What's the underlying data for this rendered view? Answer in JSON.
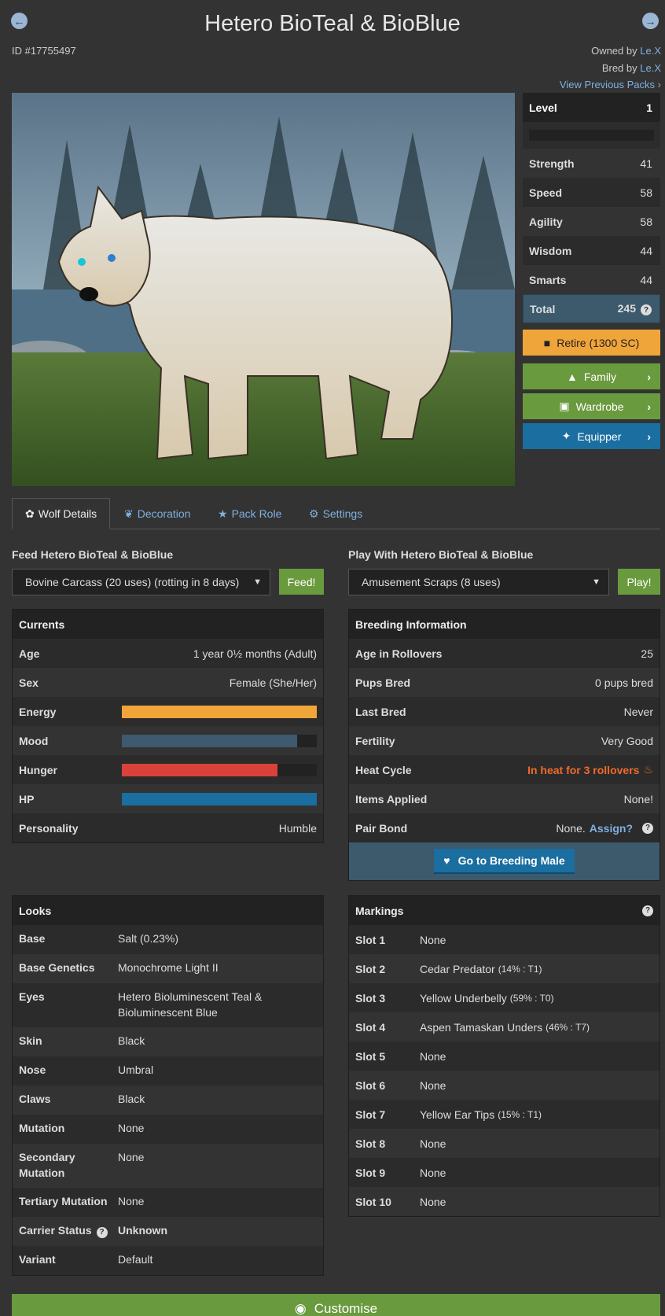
{
  "header": {
    "title": "Hetero BioTeal & BioBlue",
    "id_text": "ID #17755497",
    "owned_by_label": "Owned by",
    "owner": "Le.X",
    "bred_by_label": "Bred by",
    "breeder": "Le.X",
    "view_previous_packs": "View Previous Packs",
    "prev_icon": "arrow-left-icon",
    "next_icon": "arrow-right-icon"
  },
  "stats": {
    "level_label": "Level",
    "level": "1",
    "xp_progress": 0,
    "rows": [
      {
        "label": "Strength",
        "value": "41"
      },
      {
        "label": "Speed",
        "value": "58"
      },
      {
        "label": "Agility",
        "value": "58"
      },
      {
        "label": "Wisdom",
        "value": "44"
      },
      {
        "label": "Smarts",
        "value": "44"
      }
    ],
    "total_label": "Total",
    "total": "245"
  },
  "side_buttons": {
    "retire": "Retire (1300 SC)",
    "family": "Family",
    "wardrobe": "Wardrobe",
    "equipper": "Equipper"
  },
  "tabs": [
    "Wolf Details",
    "Decoration",
    "Pack Role",
    "Settings"
  ],
  "feed": {
    "label": "Feed Hetero BioTeal & BioBlue",
    "selected": "Bovine Carcass (20 uses) (rotting in 8 days)",
    "button": "Feed!"
  },
  "play": {
    "label": "Play With Hetero BioTeal & BioBlue",
    "selected": "Amusement Scraps (8 uses)",
    "button": "Play!"
  },
  "currents": {
    "title": "Currents",
    "age_label": "Age",
    "age": "1 year 0½ months (Adult)",
    "sex_label": "Sex",
    "sex": "Female (She/Her)",
    "energy_label": "Energy",
    "energy": 1.0,
    "mood_label": "Mood",
    "mood": 0.9,
    "hunger_label": "Hunger",
    "hunger": 0.8,
    "hp_label": "HP",
    "hp": 1.0,
    "personality_label": "Personality",
    "personality": "Humble",
    "colors": {
      "energy": "#f0a53a",
      "mood": "#3d5a6e",
      "hunger": "#d9423a",
      "hp": "#1a6ea0"
    }
  },
  "breeding": {
    "title": "Breeding Information",
    "rows": [
      {
        "label": "Age in Rollovers",
        "value": "25"
      },
      {
        "label": "Pups Bred",
        "value": "0 pups bred"
      },
      {
        "label": "Last Bred",
        "value": "Never"
      },
      {
        "label": "Fertility",
        "value": "Very Good"
      },
      {
        "label": "Heat Cycle",
        "value": "In heat for 3 rollovers"
      },
      {
        "label": "Items Applied",
        "value": "None!"
      }
    ],
    "pair_bond_label": "Pair Bond",
    "pair_bond_value": "None.",
    "assign": "Assign?",
    "go_button": "Go to Breeding Male",
    "heat_color": "#f06a2a"
  },
  "looks": {
    "title": "Looks",
    "rows": [
      {
        "label": "Base",
        "value": "Salt (0.23%)"
      },
      {
        "label": "Base Genetics",
        "value": "Monochrome Light II"
      },
      {
        "label": "Eyes",
        "value": "Hetero Bioluminescent Teal & Bioluminescent Blue"
      },
      {
        "label": "Skin",
        "value": "Black"
      },
      {
        "label": "Nose",
        "value": "Umbral"
      },
      {
        "label": "Claws",
        "value": "Black"
      },
      {
        "label": "Mutation",
        "value": "None"
      },
      {
        "label": "Secondary Mutation",
        "value": "None"
      },
      {
        "label": "Tertiary Mutation",
        "value": "None"
      }
    ],
    "carrier_label": "Carrier Status",
    "carrier_value": "Unknown",
    "variant_label": "Variant",
    "variant_value": "Default"
  },
  "markings": {
    "title": "Markings",
    "rows": [
      {
        "label": "Slot 1",
        "value": "None",
        "detail": ""
      },
      {
        "label": "Slot 2",
        "value": "Cedar Predator",
        "detail": "(14% : T1)"
      },
      {
        "label": "Slot 3",
        "value": "Yellow Underbelly",
        "detail": "(59% : T0)"
      },
      {
        "label": "Slot 4",
        "value": "Aspen Tamaskan Unders",
        "detail": "(46% : T7)"
      },
      {
        "label": "Slot 5",
        "value": "None",
        "detail": ""
      },
      {
        "label": "Slot 6",
        "value": "None",
        "detail": ""
      },
      {
        "label": "Slot 7",
        "value": "Yellow Ear Tips",
        "detail": "(15% : T1)"
      },
      {
        "label": "Slot 8",
        "value": "None",
        "detail": ""
      },
      {
        "label": "Slot 9",
        "value": "None",
        "detail": ""
      },
      {
        "label": "Slot 10",
        "value": "None",
        "detail": ""
      }
    ]
  },
  "customise": "Customise"
}
